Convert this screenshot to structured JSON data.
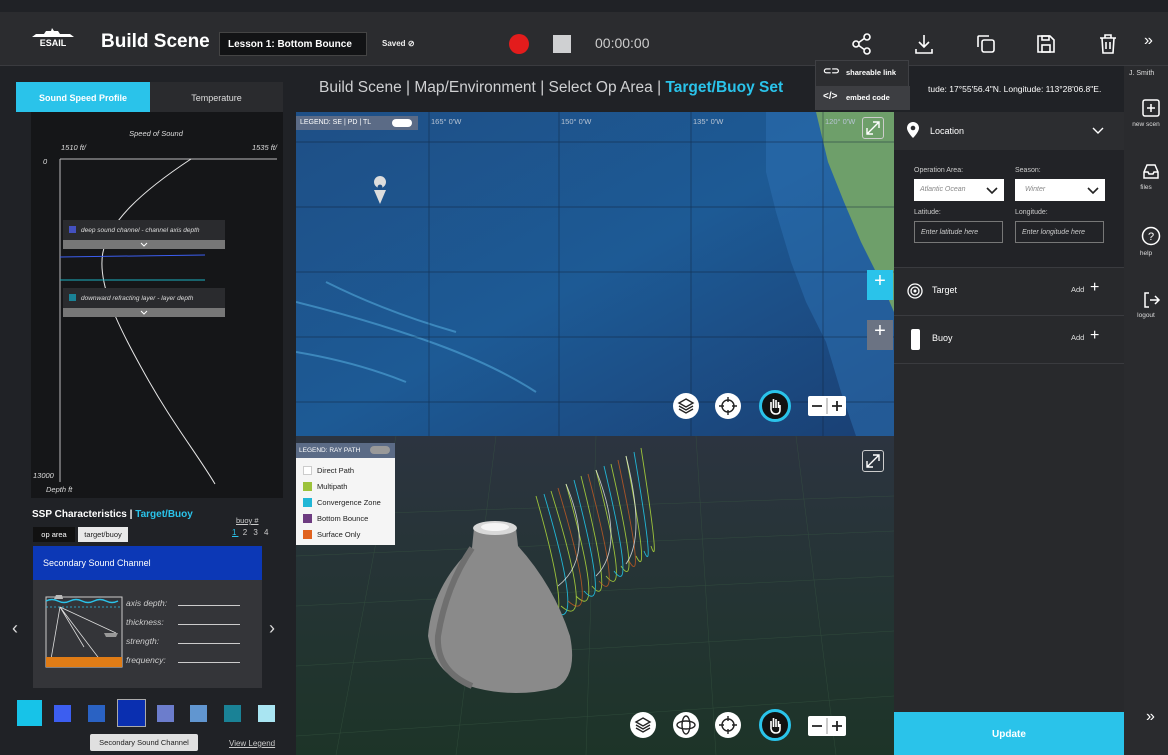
{
  "topbar": {
    "logo_text": "ESAIL",
    "title": "Build Scene",
    "lesson": "Lesson 1: Bottom Bounce",
    "saved": "Saved",
    "timer": "00:00:00"
  },
  "share_menu": {
    "link": "shareable link",
    "embed": "embed code"
  },
  "breadcrumb": {
    "steps": [
      "Build Scene",
      "Map/Environment",
      "Select Op Area"
    ],
    "active": "Target/Buoy Set",
    "separator": "|",
    "coords_visible": "tude: 17°55'56.4\"N. Longitude:   113°28'06.8\"E."
  },
  "ssp": {
    "tab_active": "Sound Speed Profile",
    "tab_other": "Temperature",
    "title": "Speed of Sound",
    "min": "1510 ft/",
    "max": "1535 ft/",
    "depth_top": "0",
    "depth_bottom": "13000",
    "depth_label": "Depth ft",
    "layer1": "deep sound channel - channel axis depth",
    "layer2": "downward refracting layer - layer depth"
  },
  "characteristics": {
    "title": "SSP Characteristics |",
    "title_accent": "Target/Buoy",
    "op_area": "op area",
    "target_buoy": "target/buoy",
    "buoy_label": "buoy #",
    "buoy_active": "1",
    "buoy_rest": "2 3 4",
    "card_title": "Secondary Sound Channel",
    "fields": [
      "axis depth:",
      "thickness:",
      "strength:",
      "frequency:"
    ],
    "tooltip": "Secondary Sound Channel",
    "view_legend": "View Legend",
    "swatches": [
      "#17c3e8",
      "#3c5ef0",
      "#2a62c3",
      "#0a2fb0",
      "#6c7dcc",
      "#6196d0",
      "#1a8296",
      "#a9e5f2"
    ]
  },
  "map": {
    "legend": "LEGEND: SE | PD | TL",
    "lon_labels": [
      "165° 0'W",
      "150° 0'W",
      "135° 0'W",
      "120° 0'W"
    ]
  },
  "scene": {
    "legend_title": "LEGEND: RAY PATH",
    "rays": [
      {
        "label": "Direct Path",
        "color": "#ffffff"
      },
      {
        "label": "Multipath",
        "color": "#9cc23a"
      },
      {
        "label": "Convergence Zone",
        "color": "#21b6d6"
      },
      {
        "label": "Bottom Bounce",
        "color": "#6d3b80"
      },
      {
        "label": "Surface Only",
        "color": "#e0621e"
      }
    ]
  },
  "location": {
    "title": "Location",
    "op_area_label": "Operation Area:",
    "op_area_value": "Atlantic Ocean",
    "season_label": "Season:",
    "season_value": "Winter",
    "lat_label": "Latitude:",
    "lat_placeholder": "Enter latitude here",
    "lon_label": "Longitude:",
    "lon_placeholder": "Enter longitude here",
    "target": "Target",
    "buoy": "Buoy",
    "add": "Add",
    "update": "Update"
  },
  "rail": {
    "user": "J. Smith",
    "new_scene": "new scen",
    "files": "files",
    "help": "help",
    "logout": "logout"
  }
}
